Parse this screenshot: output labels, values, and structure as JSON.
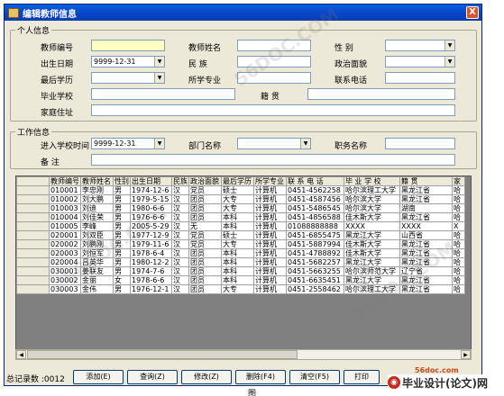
{
  "window": {
    "title": "编辑教师信息",
    "close_label": "X"
  },
  "personal": {
    "legend": "个人信息",
    "teacher_id_label": "教师编号",
    "teacher_id_value": "",
    "name_label": "教师姓名",
    "name_value": "",
    "gender_label": "性    别",
    "gender_value": "",
    "birth_label": "出生日期",
    "birth_value": "9999-12-31",
    "nation_label": "民    族",
    "nation_value": "",
    "politics_label": "政治面貌",
    "politics_value": "",
    "education_label": "最后学历",
    "education_value": "",
    "major_label": "所学专业",
    "major_value": "",
    "phone_label": "联系电话",
    "phone_value": "",
    "school_label": "毕业学校",
    "school_value": "",
    "native_label": "籍    贯",
    "native_value": "",
    "address_label": "家庭住址",
    "address_value": ""
  },
  "work": {
    "legend": "工作信息",
    "join_date_label": "进入学校时间",
    "join_date_value": "9999-12-31",
    "dept_label": "部门名称",
    "dept_value": "",
    "title_label": "职务名称",
    "title_value": "",
    "remark_label": "备    注",
    "remark_value": ""
  },
  "grid": {
    "columns": [
      "教师编号",
      "教师姓名",
      "性别",
      "出生日期",
      "民族",
      "政治面貌",
      "最后学历",
      "所学专业",
      "联 系 电 话",
      "毕 业 学 校",
      "籍    贯",
      "家"
    ],
    "rows": [
      [
        "010001",
        "李忠刚",
        "男",
        "1974-12-6",
        "汉",
        "党员",
        "硕士",
        "计算机",
        "0451-4562258",
        "哈尔滨理工大学",
        "黑龙江省",
        "哈"
      ],
      [
        "010002",
        "刘大鹏",
        "男",
        "1979-5-15",
        "汉",
        "团员",
        "大专",
        "计算机",
        "0451-4587456",
        "哈尔滨大学",
        "黑龙江省",
        "哈"
      ],
      [
        "010003",
        "刘迪",
        "男",
        "1980-6-6",
        "汉",
        "团员",
        "大专",
        "计算机",
        "0451-5486545",
        "哈尔滨大学",
        "湖南",
        "哈"
      ],
      [
        "010004",
        "刘佳荣",
        "男",
        "1976-6-6",
        "汉",
        "团员",
        "本科",
        "计算机",
        "0451-4856588",
        "佳木斯大学",
        "黑龙江省",
        "哈"
      ],
      [
        "010005",
        "李峰",
        "男",
        "2005-5-29",
        "汉",
        "无",
        "本科",
        "计算机",
        "01088888888",
        "XXXX",
        "XXXX",
        "X"
      ],
      [
        "020001",
        "刘双臣",
        "男",
        "1977-12-9",
        "汉",
        "党员",
        "硕士",
        "计算机",
        "0451-6855475",
        "黑龙江大学",
        "山西省",
        "哈"
      ],
      [
        "020002",
        "刘鹏刚",
        "男",
        "1979-11-6",
        "汉",
        "党员",
        "大专",
        "计算机",
        "0451-5887994",
        "佳木斯大学",
        "黑龙江省",
        "哈"
      ],
      [
        "020003",
        "刘恒军",
        "男",
        "1978-6-4",
        "汉",
        "团员",
        "本科",
        "计算机",
        "0451-4788892",
        "佳木斯大学",
        "黑龙江省",
        "哈"
      ],
      [
        "020004",
        "吕英华",
        "男",
        "1980-12-2",
        "汉",
        "团员",
        "本科",
        "计算机",
        "0451-5682257",
        "黑龙江大学",
        "黑龙江省",
        "哈"
      ],
      [
        "030001",
        "姜联友",
        "男",
        "1974-7-6",
        "汉",
        "团员",
        "本科",
        "计算机",
        "0451-5663255",
        "哈尔滨师范大学",
        "辽宁省",
        "哈"
      ],
      [
        "030002",
        "金丽",
        "女",
        "1978-6-6",
        "汉",
        "团员",
        "本科",
        "计算机",
        "0451-6635451",
        "黑龙江大学",
        "黑龙江省",
        "哈"
      ],
      [
        "030003",
        "金伟",
        "男",
        "1976-12-1",
        "汉",
        "团员",
        "大专",
        "计算机",
        "0451-2558462",
        "哈尔滨理工大学",
        "黑龙江省",
        "哈"
      ]
    ]
  },
  "footer": {
    "total": "总记录数 :0012",
    "add": "添加(E)",
    "query": "查询(Z)",
    "modify": "修改(Z)",
    "delete": "删除(F4)",
    "clear": "清空(F5)",
    "print": "打印",
    "site": "56doc.com",
    "banner": "毕业设计(论文)网",
    "caption": "图"
  },
  "watermark": "56DOC.COM"
}
